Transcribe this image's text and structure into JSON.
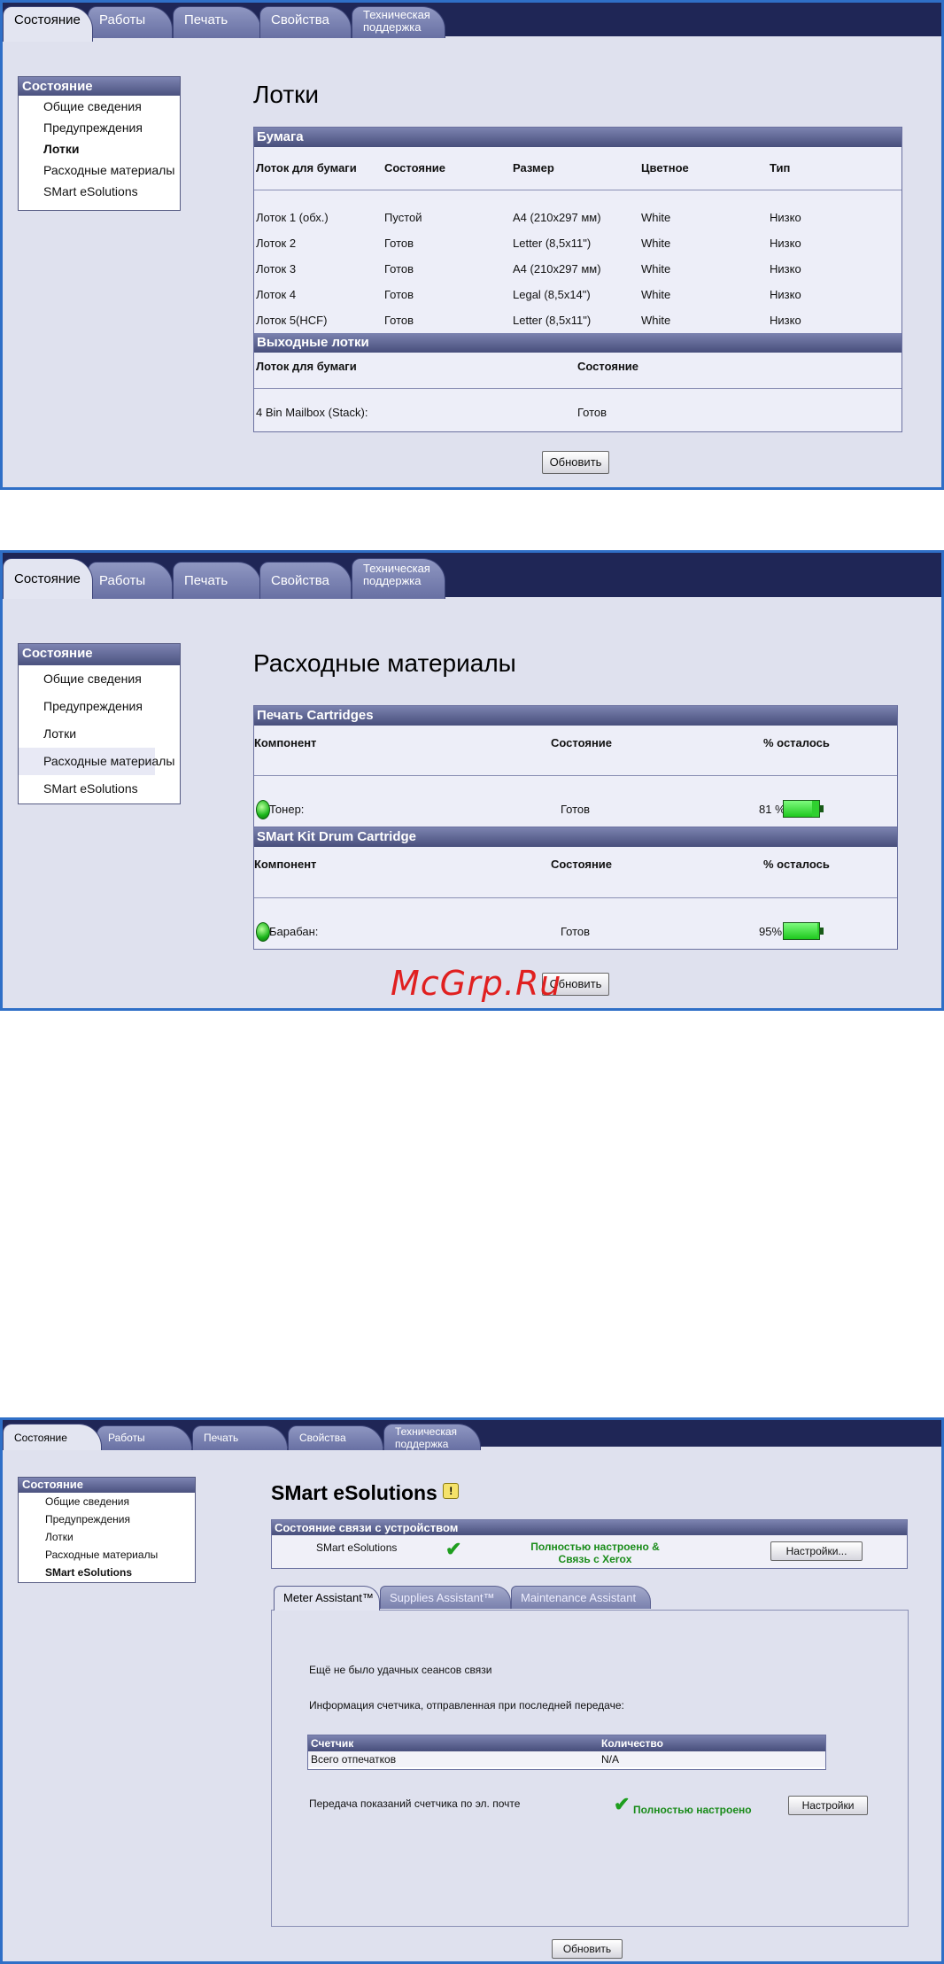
{
  "tabs": [
    "Состояние",
    "Работы",
    "Печать",
    "Свойства",
    "Техническая поддержка"
  ],
  "nav": {
    "header": "Состояние",
    "items": [
      "Общие сведения",
      "Предупреждения",
      "Лотки",
      "Расходные материалы",
      "SMart eSolutions"
    ]
  },
  "trays": {
    "title": "Лотки",
    "paper_section": "Бумага",
    "columns": [
      "Лоток для бумаги",
      "Состояние",
      "Размер",
      "Цветное",
      "Тип"
    ],
    "rows": [
      [
        "Лоток 1 (обх.)",
        "Пустой",
        "A4 (210x297 мм)",
        "White",
        "Низко"
      ],
      [
        "Лоток 2",
        "Готов",
        "Letter (8,5x11\")",
        "White",
        "Низко"
      ],
      [
        "Лоток 3",
        "Готов",
        "A4 (210x297 мм)",
        "White",
        "Низко"
      ],
      [
        "Лоток 4",
        "Готов",
        "Legal (8,5x14\")",
        "White",
        "Низко"
      ],
      [
        "Лоток 5(HCF)",
        "Готов",
        "Letter (8,5x11\")",
        "White",
        "Низко"
      ]
    ],
    "output_section": "Выходные лотки",
    "output_columns": [
      "Лоток для бумаги",
      "Состояние"
    ],
    "output_rows": [
      [
        "4 Bin Mailbox (Stack):",
        "Готов"
      ]
    ],
    "refresh_label": "Обновить"
  },
  "supplies": {
    "title": "Расходные материалы",
    "sections": [
      {
        "name": "Печать Cartridges",
        "columns": [
          "Компонент",
          "Состояние",
          "% осталось"
        ],
        "component": "Тонер:",
        "status": "Готов",
        "percent_label": "81 %",
        "level": 0.81,
        "status_color": "#22c022"
      },
      {
        "name": "SMart Kit Drum Cartridge",
        "columns": [
          "Компонент",
          "Состояние",
          "% осталось"
        ],
        "component": "Барабан:",
        "status": "Готов",
        "percent_label": "95%",
        "level": 0.95,
        "status_color": "#22c022"
      }
    ],
    "refresh_label": "Обновить",
    "watermark": "McGrp.Ru"
  },
  "smart": {
    "title": "SMart eSolutions",
    "title_icon": "info-icon",
    "conn_section": "Состояние связи с устройством",
    "conn_item": "SMart eSolutions",
    "conn_status": [
      "Полностью настроено &",
      "Связь с Xerox"
    ],
    "settings_label": "Настройки...",
    "subtabs": [
      "Meter Assistant™",
      "Supplies Assistant™",
      "Maintenance Assistant"
    ],
    "no_sessions": "Ещё не было удачных сеансов связи",
    "last_info": "Информация счетчика, отправленная при последней передаче:",
    "table_columns": [
      "Счетчик",
      "Количество"
    ],
    "table_rows": [
      [
        "Всего отпечатков",
        "N/A"
      ]
    ],
    "email_label": "Передача показаний счетчика по эл. почте",
    "email_status": "Полностью настроено",
    "email_settings_label": "Настройки",
    "refresh_label": "Обновить"
  },
  "colors": {
    "tabbar": "#1f2656",
    "frame": "#2f6fc7",
    "panel": "#dfe1ee",
    "ok": "#22c022"
  }
}
